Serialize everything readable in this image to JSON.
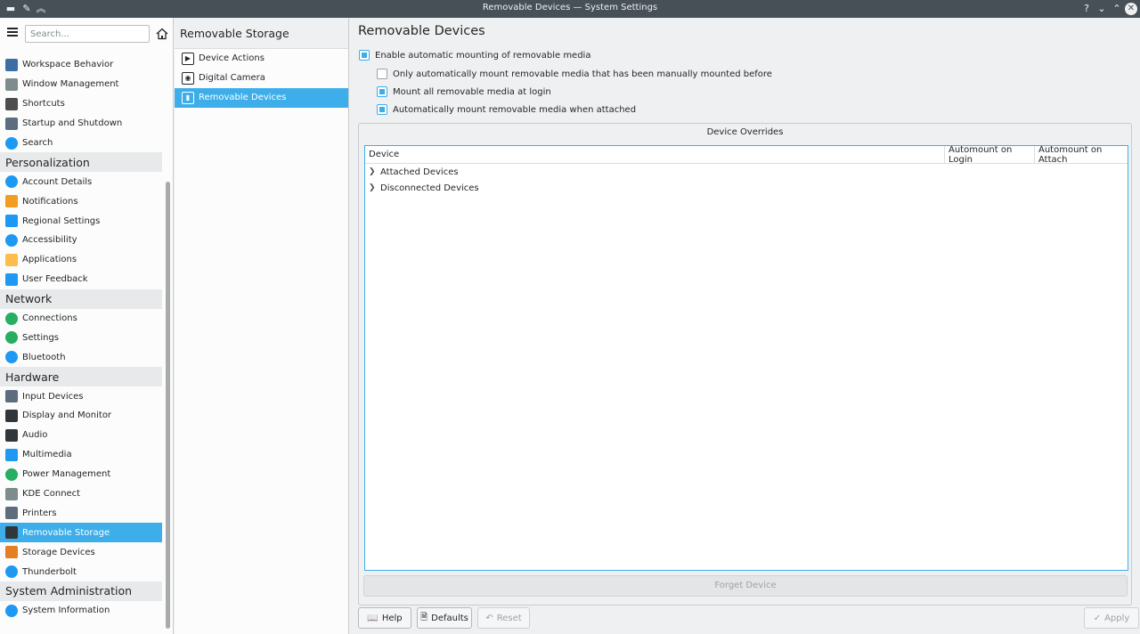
{
  "window": {
    "title": "Removable Devices — System Settings"
  },
  "sidebar": {
    "search_placeholder": "Search...",
    "items": [
      {
        "type": "item",
        "label": "Workspace Behavior",
        "icon": "workspace-behavior-icon",
        "color": "#3a6ea5"
      },
      {
        "type": "item",
        "label": "Window Management",
        "icon": "window-management-icon",
        "color": "#7f8c8d"
      },
      {
        "type": "item",
        "label": "Shortcuts",
        "icon": "keyboard-icon",
        "color": "#4d4d4d"
      },
      {
        "type": "item",
        "label": "Startup and Shutdown",
        "icon": "startup-icon",
        "color": "#5d6d7e"
      },
      {
        "type": "item",
        "label": "Search",
        "icon": "search-icon",
        "color": "#1d99f3"
      },
      {
        "type": "category",
        "label": "Personalization"
      },
      {
        "type": "item",
        "label": "Account Details",
        "icon": "account-icon",
        "color": "#1d99f3"
      },
      {
        "type": "item",
        "label": "Notifications",
        "icon": "bell-icon",
        "color": "#f39c1f"
      },
      {
        "type": "item",
        "label": "Regional Settings",
        "icon": "regional-icon",
        "color": "#1d99f3"
      },
      {
        "type": "item",
        "label": "Accessibility",
        "icon": "accessibility-icon",
        "color": "#1d99f3"
      },
      {
        "type": "item",
        "label": "Applications",
        "icon": "star-icon",
        "color": "#fdbc4b"
      },
      {
        "type": "item",
        "label": "User Feedback",
        "icon": "feedback-icon",
        "color": "#1d99f3"
      },
      {
        "type": "category",
        "label": "Network"
      },
      {
        "type": "item",
        "label": "Connections",
        "icon": "globe-icon",
        "color": "#27ae60"
      },
      {
        "type": "item",
        "label": "Settings",
        "icon": "globe-icon",
        "color": "#27ae60"
      },
      {
        "type": "item",
        "label": "Bluetooth",
        "icon": "bluetooth-icon",
        "color": "#1d99f3"
      },
      {
        "type": "category",
        "label": "Hardware"
      },
      {
        "type": "item",
        "label": "Input Devices",
        "icon": "input-devices-icon",
        "color": "#5d6d7e"
      },
      {
        "type": "item",
        "label": "Display and Monitor",
        "icon": "monitor-icon",
        "color": "#31363b"
      },
      {
        "type": "item",
        "label": "Audio",
        "icon": "audio-icon",
        "color": "#31363b"
      },
      {
        "type": "item",
        "label": "Multimedia",
        "icon": "multimedia-icon",
        "color": "#1d99f3"
      },
      {
        "type": "item",
        "label": "Power Management",
        "icon": "power-icon",
        "color": "#27ae60"
      },
      {
        "type": "item",
        "label": "KDE Connect",
        "icon": "phone-icon",
        "color": "#7f8c8d"
      },
      {
        "type": "item",
        "label": "Printers",
        "icon": "printer-icon",
        "color": "#5d6d7e"
      },
      {
        "type": "item",
        "label": "Removable Storage",
        "icon": "usb-icon",
        "color": "#31363b",
        "selected": true
      },
      {
        "type": "item",
        "label": "Storage Devices",
        "icon": "storage-icon",
        "color": "#e67e22"
      },
      {
        "type": "item",
        "label": "Thunderbolt",
        "icon": "thunderbolt-icon",
        "color": "#1d99f3"
      },
      {
        "type": "category",
        "label": "System Administration"
      },
      {
        "type": "item",
        "label": "System Information",
        "icon": "info-icon",
        "color": "#1d99f3"
      }
    ]
  },
  "middle": {
    "header": "Removable Storage",
    "items": [
      {
        "label": "Device Actions",
        "icon": "device-actions-icon",
        "glyph": "▶"
      },
      {
        "label": "Digital Camera",
        "icon": "camera-icon",
        "glyph": "◉"
      },
      {
        "label": "Removable Devices",
        "icon": "usb-icon",
        "glyph": "▮",
        "selected": true
      }
    ]
  },
  "main": {
    "title": "Removable Devices",
    "options": {
      "enable": {
        "label": "Enable automatic mounting of removable media",
        "checked": true
      },
      "only_manual": {
        "label": "Only automatically mount removable media that has been manually mounted before",
        "checked": false
      },
      "mount_login": {
        "label": "Mount all removable media at login",
        "checked": true
      },
      "mount_attach": {
        "label": "Automatically mount removable media when attached",
        "checked": true
      }
    },
    "overrides": {
      "title": "Device Overrides",
      "columns": [
        "Device",
        "Automount on Login",
        "Automount on Attach"
      ],
      "rows": [
        "Attached Devices",
        "Disconnected Devices"
      ],
      "forget_label": "Forget Device"
    },
    "buttons": {
      "help": "Help",
      "defaults": "Defaults",
      "reset": "Reset",
      "apply": "Apply"
    }
  },
  "colors": {
    "accent": "#3daee9",
    "titlebar": "#475057",
    "window_bg": "#eff0f1"
  }
}
